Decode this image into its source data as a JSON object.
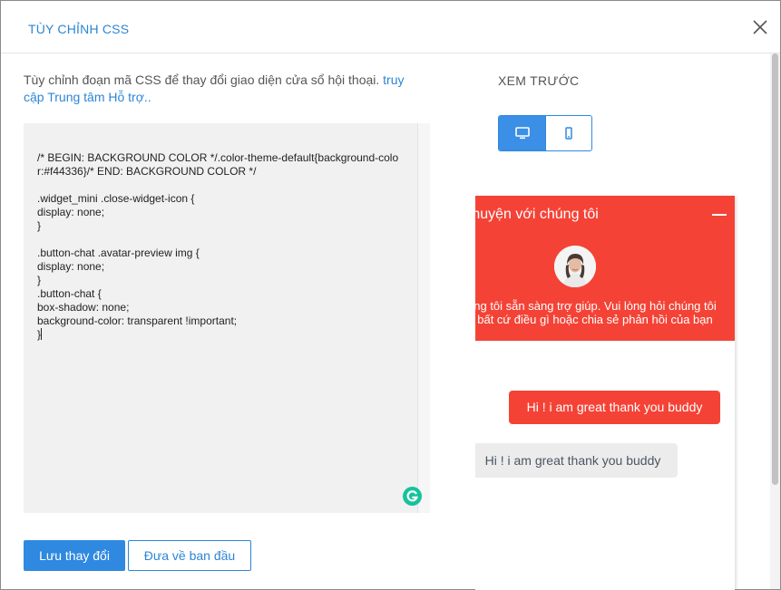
{
  "dialog": {
    "title": "TÙY CHỈNH CSS",
    "close_icon": "close-icon"
  },
  "description": {
    "text": "Tùy chỉnh đoạn mã CSS để thay đổi giao diện cửa sổ hội thoại. ",
    "link_text": "truy cập Trung tâm Hỗ trợ.."
  },
  "editor": {
    "code": "/* BEGIN: BACKGROUND COLOR */.color-theme-default{background-color:#f44336}/* END: BACKGROUND COLOR */\n\n.widget_mini .close-widget-icon {\ndisplay: none;\n}\n\n.button-chat .avatar-preview img {\ndisplay: none;\n}\n.button-chat {\nbox-shadow: none;\nbackground-color: transparent !important;\n}",
    "grammarly_icon": "grammarly-icon"
  },
  "buttons": {
    "save_label": "Lưu thay đổi",
    "reset_label": "Đưa về ban đầu"
  },
  "preview": {
    "label": "XEM TRƯỚC",
    "device_toggle": {
      "options": [
        "desktop-icon",
        "mobile-icon"
      ],
      "selected": "desktop"
    },
    "widget": {
      "header_title": "ò chuyện với chúng tôi",
      "header_message": "ng tôi sẵn sàng trợ giúp. Vui lòng hỏi chúng tôi\nbất cứ điều gì hoặc chia sẻ phản hồi của bạn",
      "bubble_sent": "Hi ! i am great thank you buddy",
      "bubble_received": "Hi ! i am great thank you buddy",
      "theme_color": "#f44336"
    }
  },
  "colors": {
    "accent": "#2f89e0",
    "theme": "#f44336"
  }
}
